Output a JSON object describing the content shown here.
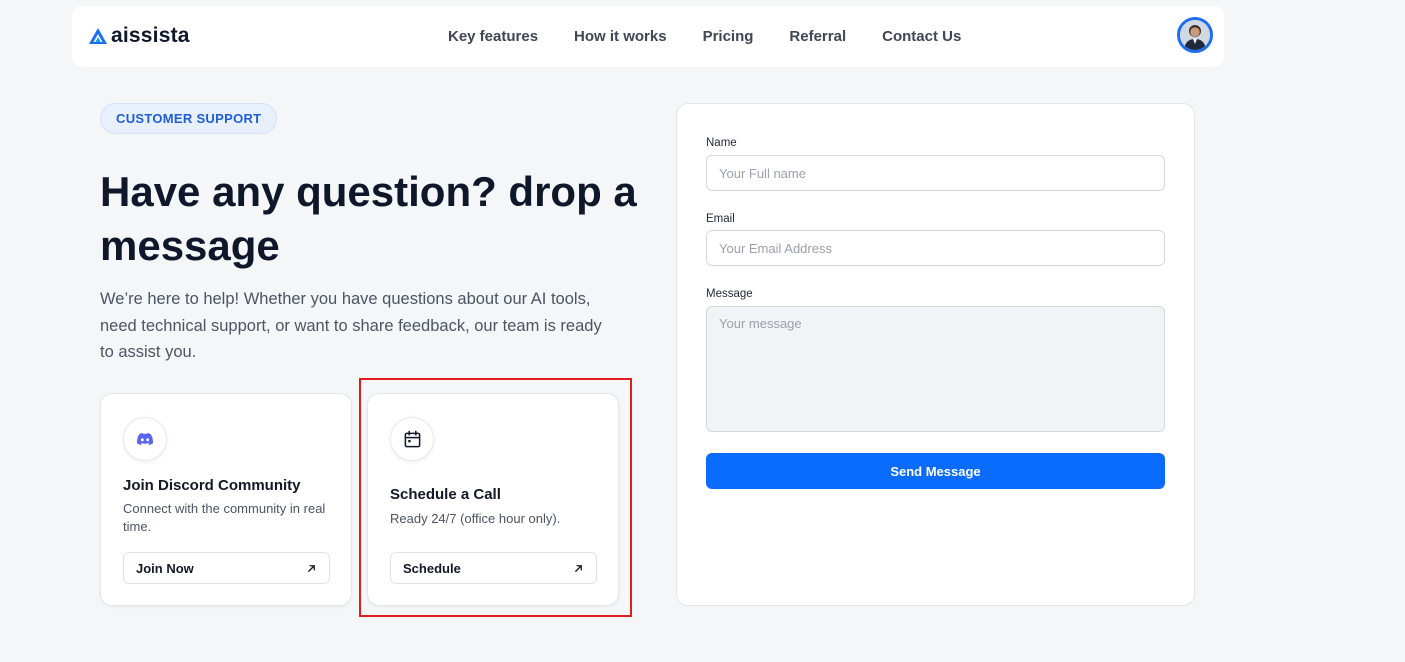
{
  "header": {
    "logo_text": "aissista",
    "nav": [
      "Key features",
      "How it works",
      "Pricing",
      "Referral",
      "Contact Us"
    ]
  },
  "hero": {
    "badge": "CUSTOMER SUPPORT",
    "headline": "Have any question? drop a message",
    "intro": "We’re here to help! Whether you have questions about our AI tools, need technical support, or want to share feedback, our team is ready to assist you."
  },
  "cards": [
    {
      "icon": "discord-icon",
      "title": "Join Discord Community",
      "description": "Connect with the community in real time.",
      "button": "Join Now"
    },
    {
      "icon": "calendar-icon",
      "title": "Schedule a Call",
      "description": "Ready 24/7 (office hour only).",
      "button": "Schedule"
    }
  ],
  "form": {
    "name_label": "Name",
    "name_placeholder": "Your Full name",
    "email_label": "Email",
    "email_placeholder": "Your Email Address",
    "message_label": "Message",
    "message_placeholder": "Your message",
    "submit": "Send Message"
  },
  "colors": {
    "accent": "#0a6cff",
    "badge_text": "#1e5fd8",
    "highlight": "#e11d1d"
  }
}
